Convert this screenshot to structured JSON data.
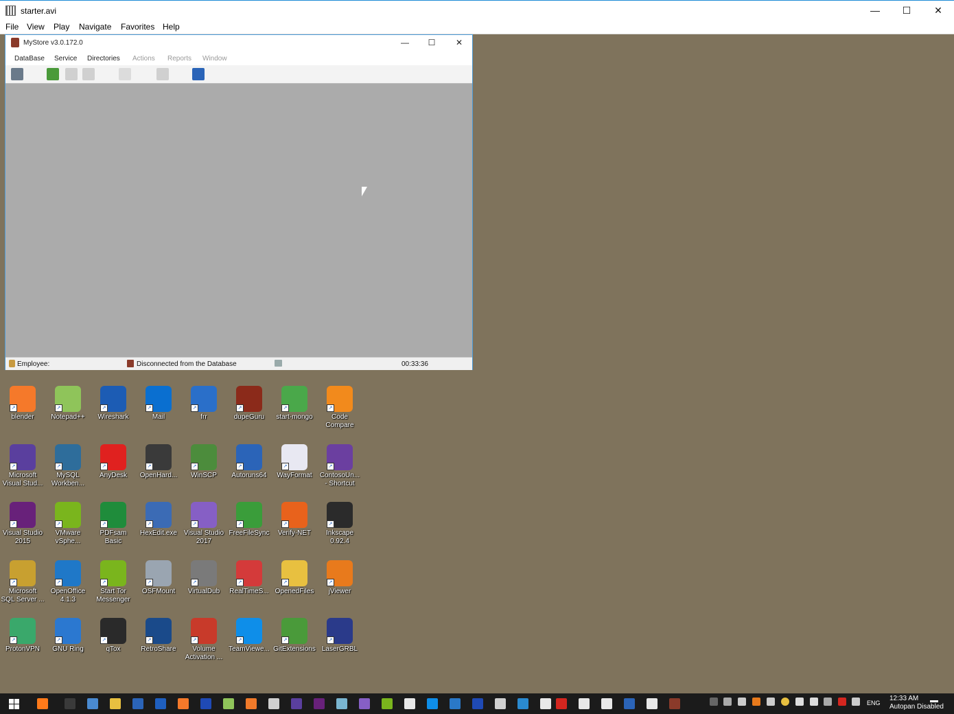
{
  "player": {
    "title": "starter.avi",
    "menu": [
      "File",
      "View",
      "Play",
      "Navigate",
      "Favorites",
      "Help"
    ],
    "controls": {
      "minimize": "—",
      "maximize": "☐",
      "close": "✕"
    }
  },
  "mystore": {
    "title": "MyStore v3.0.172.0",
    "menu": [
      "DataBase",
      "Service",
      "Directories",
      "Actions",
      "Reports",
      "Window"
    ],
    "controls": {
      "minimize": "—",
      "maximize": "☐",
      "close": "✕"
    },
    "status": {
      "employee": "Employee:",
      "db_state": "Disconnected from the Database",
      "time": "00:33:36"
    }
  },
  "desktop_icons": [
    {
      "label": "blender",
      "color": "#f5792a"
    },
    {
      "label": "Notepad++",
      "color": "#8fc45a"
    },
    {
      "label": "Wireshark",
      "color": "#1c5cb4"
    },
    {
      "label": "Mail",
      "color": "#0a6fd0"
    },
    {
      "label": "frr",
      "color": "#2a6fc9"
    },
    {
      "label": "dupeGuru",
      "color": "#8b2a1a"
    },
    {
      "label": "start-mongo",
      "color": "#4aa84a"
    },
    {
      "label": "Code\nCompare",
      "color": "#f28a1c"
    },
    {
      "label": "Microsoft\nVisual Stud...",
      "color": "#5a3f9e"
    },
    {
      "label": "MySQL\nWorkben...",
      "color": "#2e6d9b"
    },
    {
      "label": "AnyDesk",
      "color": "#e0211f"
    },
    {
      "label": "OpenHard...",
      "color": "#3a3a3a"
    },
    {
      "label": "WinSCP",
      "color": "#4c8c3c"
    },
    {
      "label": "Autoruns64",
      "color": "#2b64b8"
    },
    {
      "label": "WayFormat",
      "color": "#e8e8f2"
    },
    {
      "label": "ContosoUn...\n- Shortcut",
      "color": "#6b3fa0"
    },
    {
      "label": "Visual Studio\n2015",
      "color": "#68217a"
    },
    {
      "label": "VMware\nvSphe...",
      "color": "#7ab51d"
    },
    {
      "label": "PDFsam\nBasic",
      "color": "#1f8c3b"
    },
    {
      "label": "HexEdit.exe",
      "color": "#3b6bb5"
    },
    {
      "label": "Visual Studio\n2017",
      "color": "#865fc5"
    },
    {
      "label": "FreeFileSync",
      "color": "#3a9d3a"
    },
    {
      "label": "Verify-NET",
      "color": "#e8621c"
    },
    {
      "label": "Inkscape\n0.92.4",
      "color": "#2b2b2b"
    },
    {
      "label": "Microsoft\nSQL Server ...",
      "color": "#c8a030"
    },
    {
      "label": "OpenOffice\n4.1.3",
      "color": "#1f78c8"
    },
    {
      "label": "Start Tor\nMessenger",
      "color": "#7ab51d"
    },
    {
      "label": "OSFMount",
      "color": "#9aa5b1"
    },
    {
      "label": "VirtualDub",
      "color": "#7a7a7a"
    },
    {
      "label": "RealTimeS...",
      "color": "#d43a3a"
    },
    {
      "label": "OpenedFiles",
      "color": "#e8c040"
    },
    {
      "label": "jViewer",
      "color": "#e87a1c"
    },
    {
      "label": "ProtonVPN",
      "color": "#3aa86b"
    },
    {
      "label": "GNU Ring",
      "color": "#2b78d0"
    },
    {
      "label": "qTox",
      "color": "#2a2a2a"
    },
    {
      "label": "RetroShare",
      "color": "#1a4a8a"
    },
    {
      "label": "Volume\nActivation ...",
      "color": "#c83a2a"
    },
    {
      "label": "TeamViewe...",
      "color": "#0e8ee9"
    },
    {
      "label": "GitExtensions",
      "color": "#4a9a3a"
    },
    {
      "label": "LaserGRBL",
      "color": "#2a3a8a"
    }
  ],
  "taskbar": {
    "language": "ENG",
    "time": "12:33 AM",
    "status_text": "Autopan Disabled",
    "apps": [
      "#ff7a1a",
      "#3a3a3a",
      "#4a8ad0",
      "#e8c040",
      "#2b64b8",
      "#1f5fbf",
      "#f5792a",
      "#1f4ab5",
      "#8fc45a",
      "#f07a2a",
      "#d0d0d0",
      "#5a3f9e",
      "#68217a",
      "#7ab5d0",
      "#865fc5",
      "#7ab51d",
      "#e8e8e8",
      "#0e8ee9",
      "#2a78c8",
      "#1f4ab5",
      "#d0d0d0",
      "#2a8ad0",
      "#e8e8e8",
      "#d4261f",
      "#e8e8e8",
      "#e8e8e8",
      "#2b64b8",
      "#e8e8e8",
      "#8a3a2a"
    ]
  }
}
